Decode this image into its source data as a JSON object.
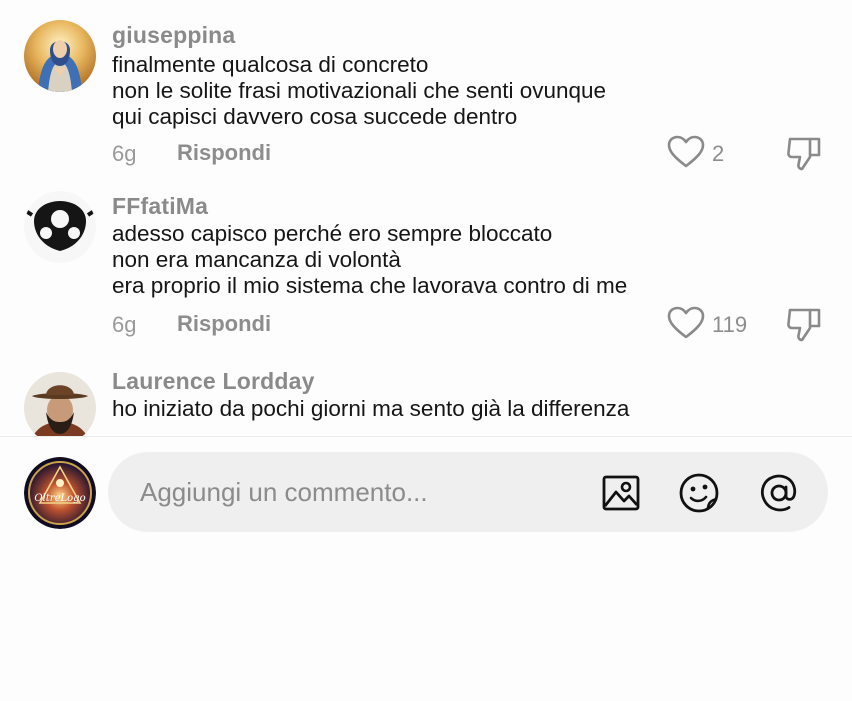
{
  "comments": [
    {
      "username": "giuseppina",
      "lines": [
        "finalmente qualcosa di concreto",
        "non le solite frasi motivazionali che senti ovunque",
        "qui capisci davvero cosa succede dentro"
      ],
      "time": "6g",
      "reply_label": "Rispondi",
      "likes": "2",
      "avatar_icon": "madonna-portrait"
    },
    {
      "username": "FFfatiMa",
      "lines": [
        "adesso capisco perché ero sempre bloccato",
        "non era mancanza di volontà",
        "era proprio il mio sistema che lavorava contro di me"
      ],
      "time": "6g",
      "reply_label": "Rispondi",
      "likes": "119",
      "avatar_icon": "black-mask"
    },
    {
      "username": "Laurence Lordday",
      "lines": [
        "ho iniziato da pochi giorni ma sento già la differenza"
      ],
      "time": "",
      "reply_label": "",
      "likes": "",
      "avatar_icon": "bearded-man-with-hat"
    }
  ],
  "composer": {
    "placeholder": "Aggiungi un commento...",
    "avatar_logo_text": "OltreLogo",
    "icons": [
      "image-icon",
      "emoji-icon",
      "mention-icon"
    ]
  },
  "colors": {
    "username": "#8a8a8a",
    "text": "#161616",
    "meta": "#8d8d8d",
    "composer_bg": "#efefef"
  }
}
